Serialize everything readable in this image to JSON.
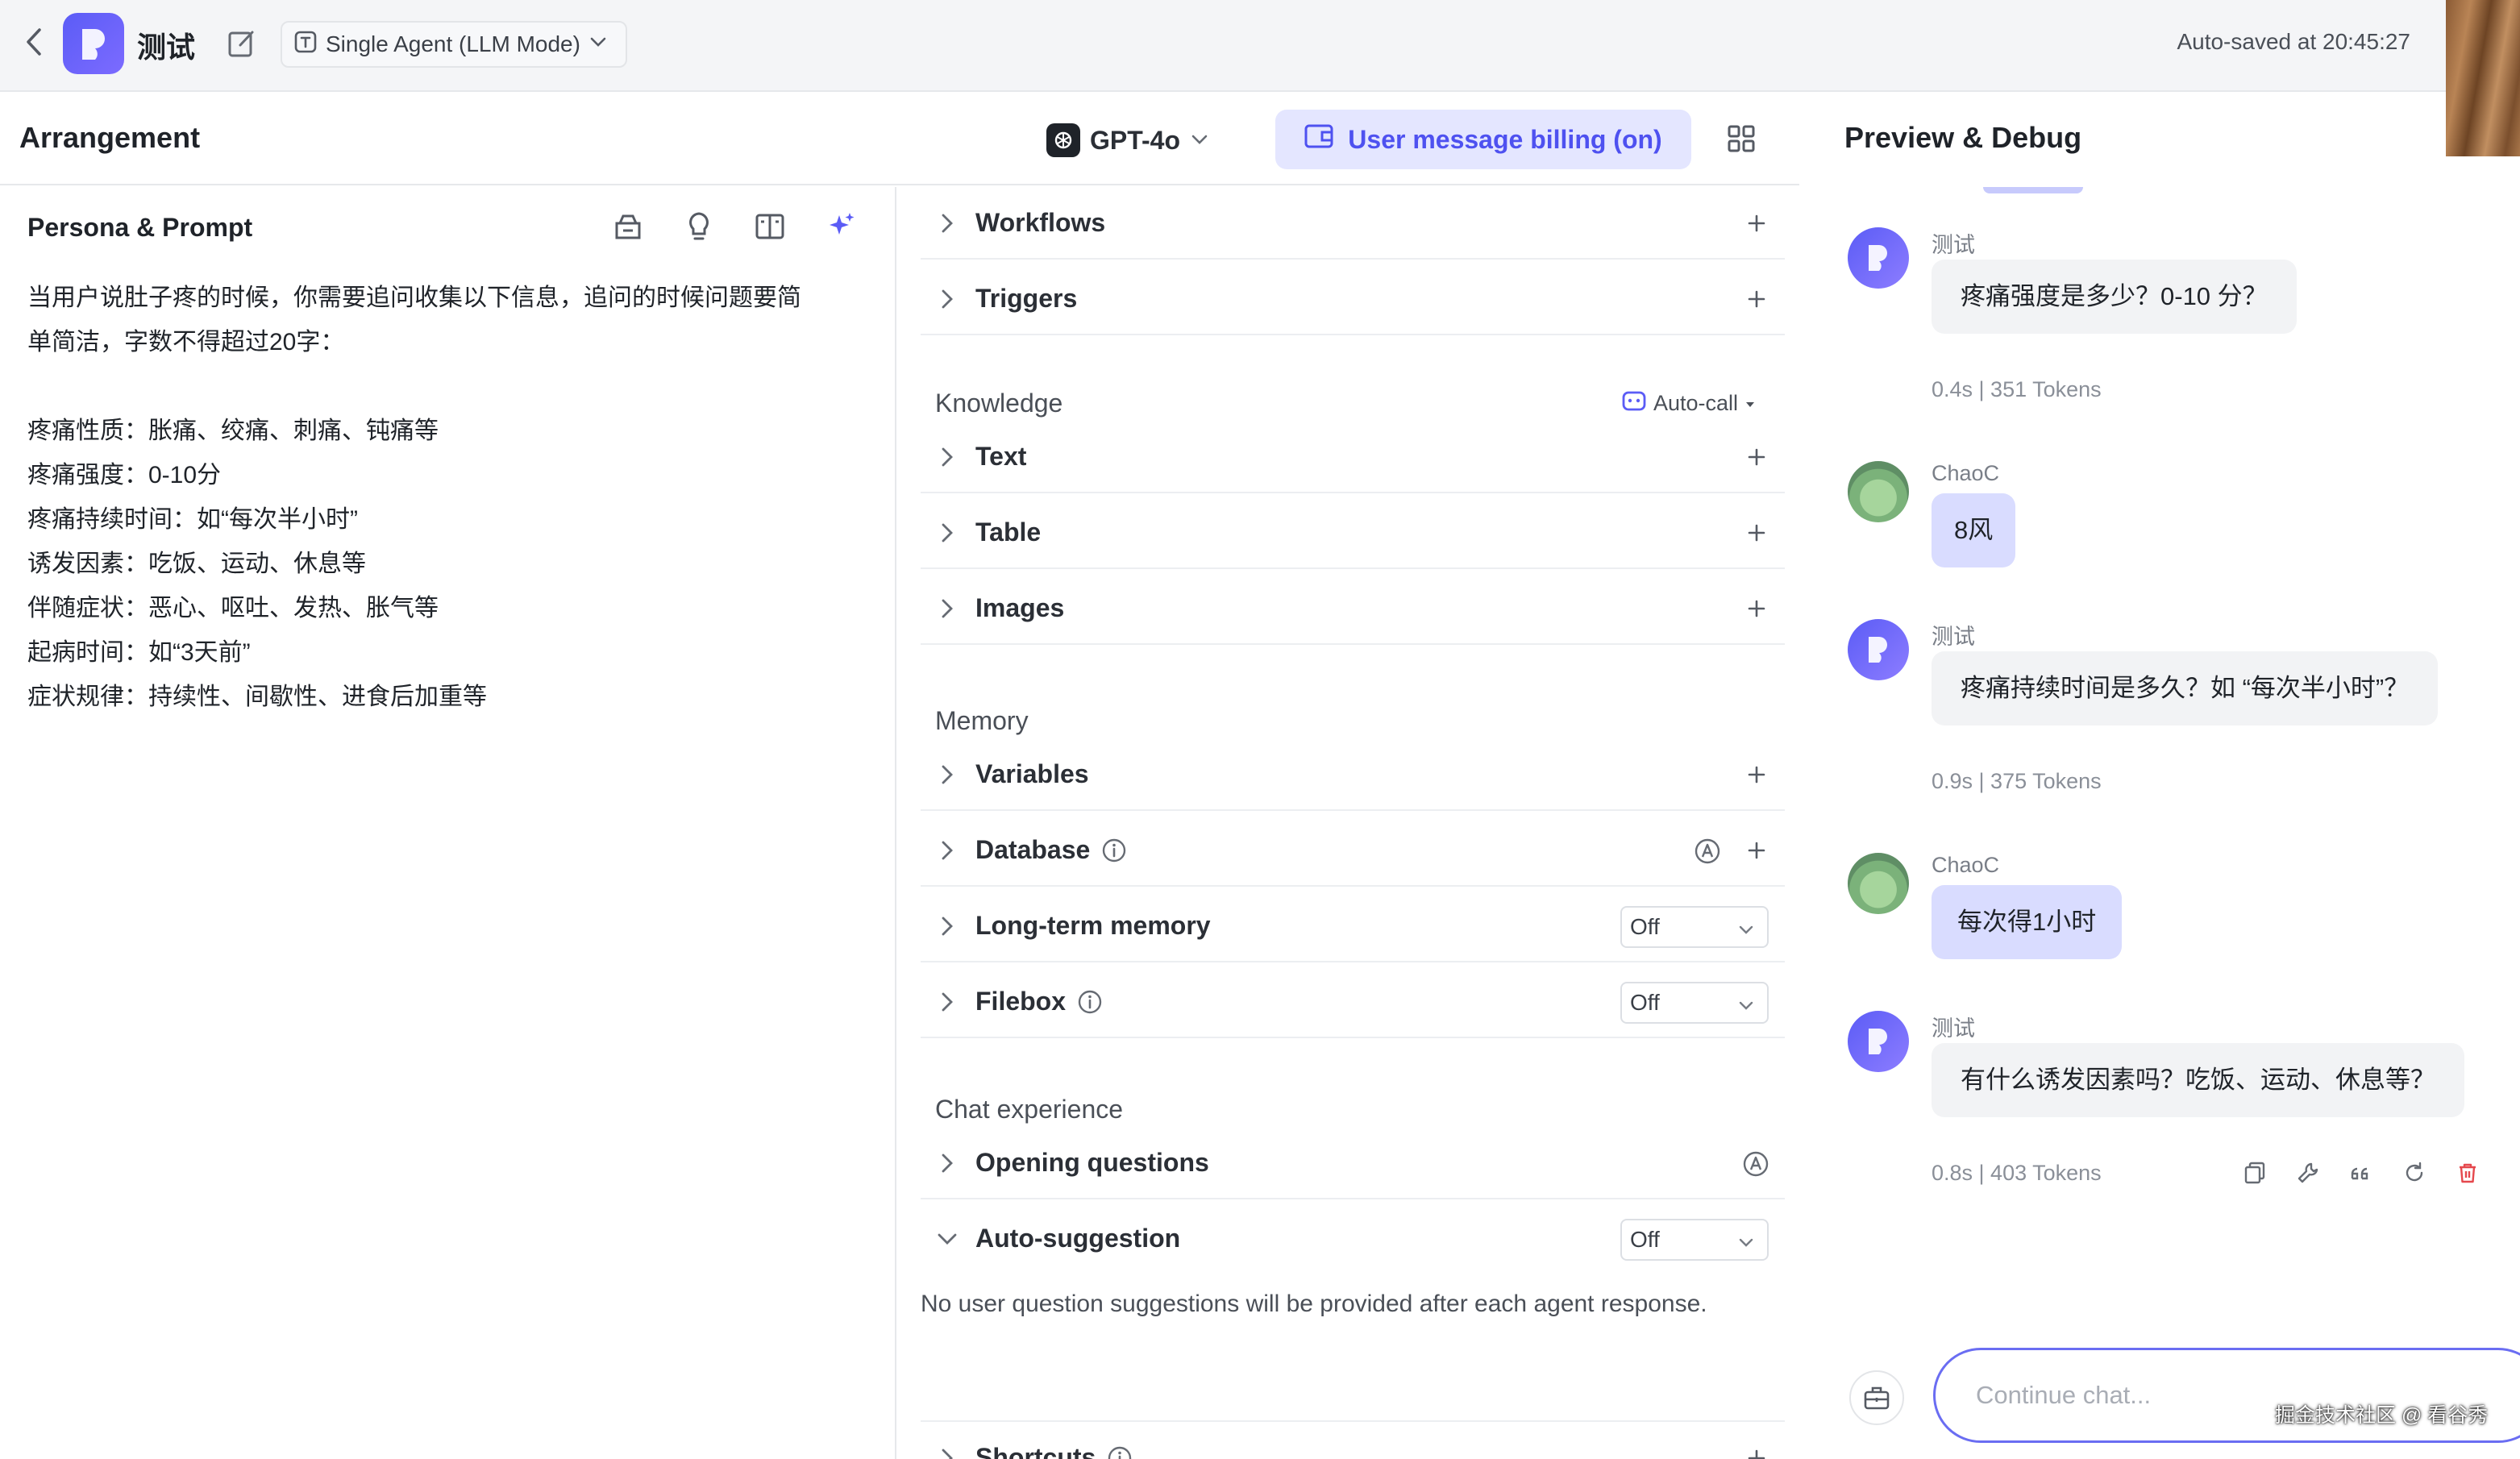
{
  "topbar": {
    "app_name": "测试",
    "mode_label": "Single Agent (LLM Mode)",
    "autosave": "Auto-saved at 20:45:27"
  },
  "arrangement": {
    "title": "Arrangement",
    "model": "GPT-4o",
    "billing_label": "User message billing (on)"
  },
  "persona": {
    "title": "Persona & Prompt",
    "lines": [
      "当用户说肚子疼的时候，你需要追问收集以下信息，追问的时候问题要简",
      "单简洁，字数不得超过20字：",
      "",
      "疼痛性质：胀痛、绞痛、刺痛、钝痛等",
      "疼痛强度：0-10分",
      "疼痛持续时间：如“每次半小时”",
      "诱发因素：吃饭、运动、休息等",
      "伴随症状：恶心、呕吐、发热、胀气等",
      "起病时间：如“3天前”",
      "症状规律：持续性、间歇性、进食后加重等"
    ]
  },
  "skills": {
    "workflows": "Workflows",
    "triggers": "Triggers",
    "knowledge": {
      "title": "Knowledge",
      "auto_call": "Auto-call",
      "text": "Text",
      "table": "Table",
      "images": "Images"
    },
    "memory": {
      "title": "Memory",
      "variables": "Variables",
      "database": "Database",
      "long_term": "Long-term memory",
      "long_term_value": "Off",
      "filebox": "Filebox",
      "filebox_value": "Off"
    },
    "chat_experience": {
      "title": "Chat experience",
      "opening_questions": "Opening questions",
      "auto_suggestion": "Auto-suggestion",
      "auto_suggestion_value": "Off",
      "auto_suggestion_desc": "No user question suggestions will be provided after each agent response.",
      "shortcuts": "Shortcuts"
    }
  },
  "preview": {
    "title": "Preview & Debug",
    "messages": [
      {
        "role": "bot",
        "name": "测试",
        "text": "疼痛强度是多少？0-10 分？",
        "meta": "0.4s | 351 Tokens"
      },
      {
        "role": "user",
        "name": "ChaoC",
        "text": "8风"
      },
      {
        "role": "bot",
        "name": "测试",
        "text": "疼痛持续时间是多久？如 “每次半小时”？",
        "meta": "0.9s | 375 Tokens"
      },
      {
        "role": "user",
        "name": "ChaoC",
        "text": "每次得1小时"
      },
      {
        "role": "bot",
        "name": "测试",
        "text": "有什么诱发因素吗？吃饭、运动、休息等？",
        "meta": "0.8s | 403 Tokens"
      }
    ],
    "input_placeholder": "Continue chat...",
    "watermark": "掘金技术社区 @ 看谷秀"
  },
  "colors": {
    "accent": "#4e51f0",
    "accent_bg": "#e4e6ff",
    "user_bubble": "#d9dcff",
    "bot_bubble": "#f2f3f5",
    "delete": "#e5484d"
  }
}
